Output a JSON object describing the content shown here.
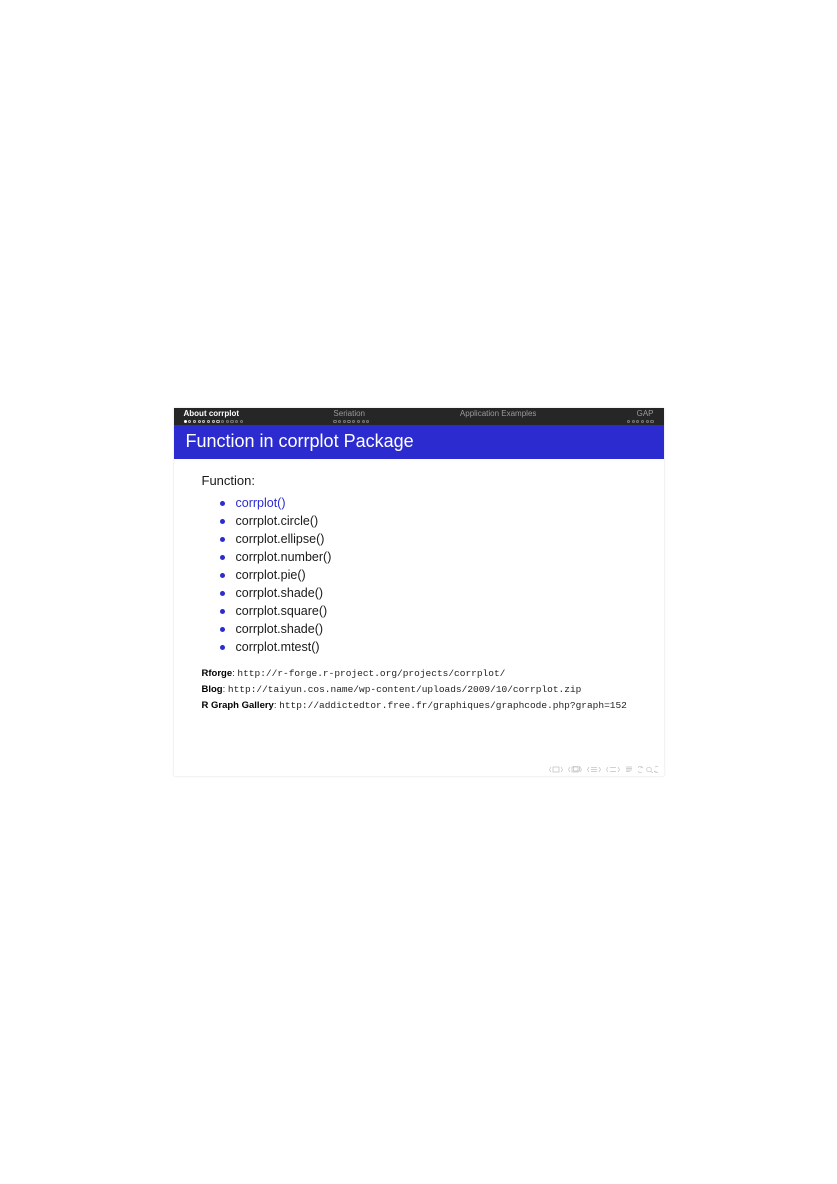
{
  "nav": {
    "sections": [
      {
        "label": "About corrplot",
        "active": true,
        "dots_total": 13,
        "dots_filled": 1,
        "align": "left"
      },
      {
        "label": "Seriation",
        "active": false,
        "dots_total": 8,
        "dots_filled": 0,
        "align": "left"
      },
      {
        "label": "Application Examples",
        "active": false,
        "dots_total": 0,
        "dots_filled": 0,
        "align": "left"
      },
      {
        "label": "GAP",
        "active": false,
        "dots_total": 6,
        "dots_filled": 0,
        "align": "right"
      }
    ]
  },
  "title": "Function in corrplot Package",
  "block_heading": "Function:",
  "functions": [
    {
      "name": "corrplot()",
      "highlight": true
    },
    {
      "name": "corrplot.circle()",
      "highlight": false
    },
    {
      "name": "corrplot.ellipse()",
      "highlight": false
    },
    {
      "name": "corrplot.number()",
      "highlight": false
    },
    {
      "name": "corrplot.pie()",
      "highlight": false
    },
    {
      "name": "corrplot.shade()",
      "highlight": false
    },
    {
      "name": "corrplot.square()",
      "highlight": false
    },
    {
      "name": "corrplot.shade()",
      "highlight": false
    },
    {
      "name": "corrplot.mtest()",
      "highlight": false
    }
  ],
  "refs": [
    {
      "label": "Rforge",
      "url": "http://r-forge.r-project.org/projects/corrplot/"
    },
    {
      "label": "Blog",
      "url": "http://taiyun.cos.name/wp-content/uploads/2009/10/corrplot.zip"
    },
    {
      "label": "R Graph Gallery",
      "url": "http://addictedtor.free.fr/graphiques/graphcode.php?graph=152"
    }
  ],
  "sep": ": "
}
